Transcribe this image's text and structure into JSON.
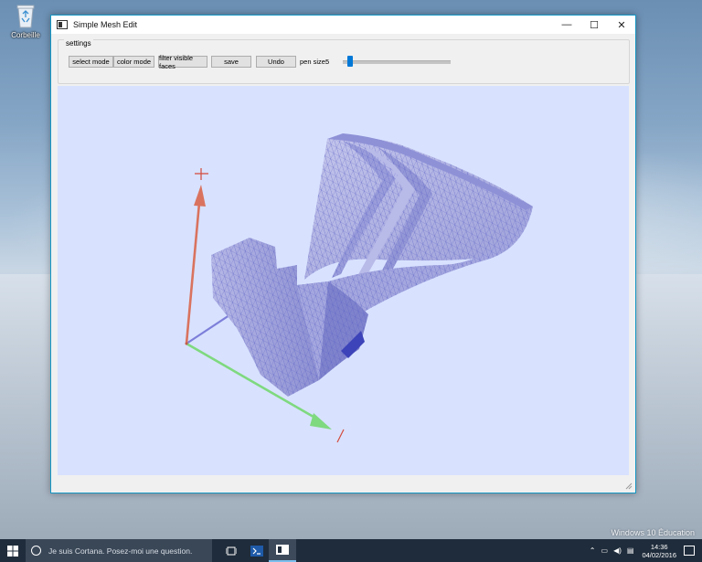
{
  "desktop": {
    "recycle_bin_label": "Corbeille",
    "watermark": "Windows 10 Éducation"
  },
  "window": {
    "title": "Simple Mesh Edit",
    "controls": {
      "minimize": "—",
      "maximize": "☐",
      "close": "✕"
    }
  },
  "settings": {
    "group_title": "settings",
    "buttons": {
      "select_mode": "select mode",
      "color_mode": "color mode",
      "filter_visible_faces": "filter visible faces",
      "save": "save",
      "undo": "Undo"
    },
    "pen_size_label": "pen size:",
    "pen_size_value": "5",
    "pen_size_slider_fraction": 0.04
  },
  "viewport": {
    "background": "#d8e2ff",
    "mesh_color": "#a9acde",
    "mesh_line_color": "#5a5fc4",
    "axes": {
      "up": "#d9735f",
      "forward": "#7fd97f",
      "depth": "#7d7fd9"
    }
  },
  "taskbar": {
    "search_placeholder": "Je suis Cortana. Posez-moi une question.",
    "time": "14:36",
    "date": "04/02/2016",
    "accent": "#7cbfee"
  }
}
